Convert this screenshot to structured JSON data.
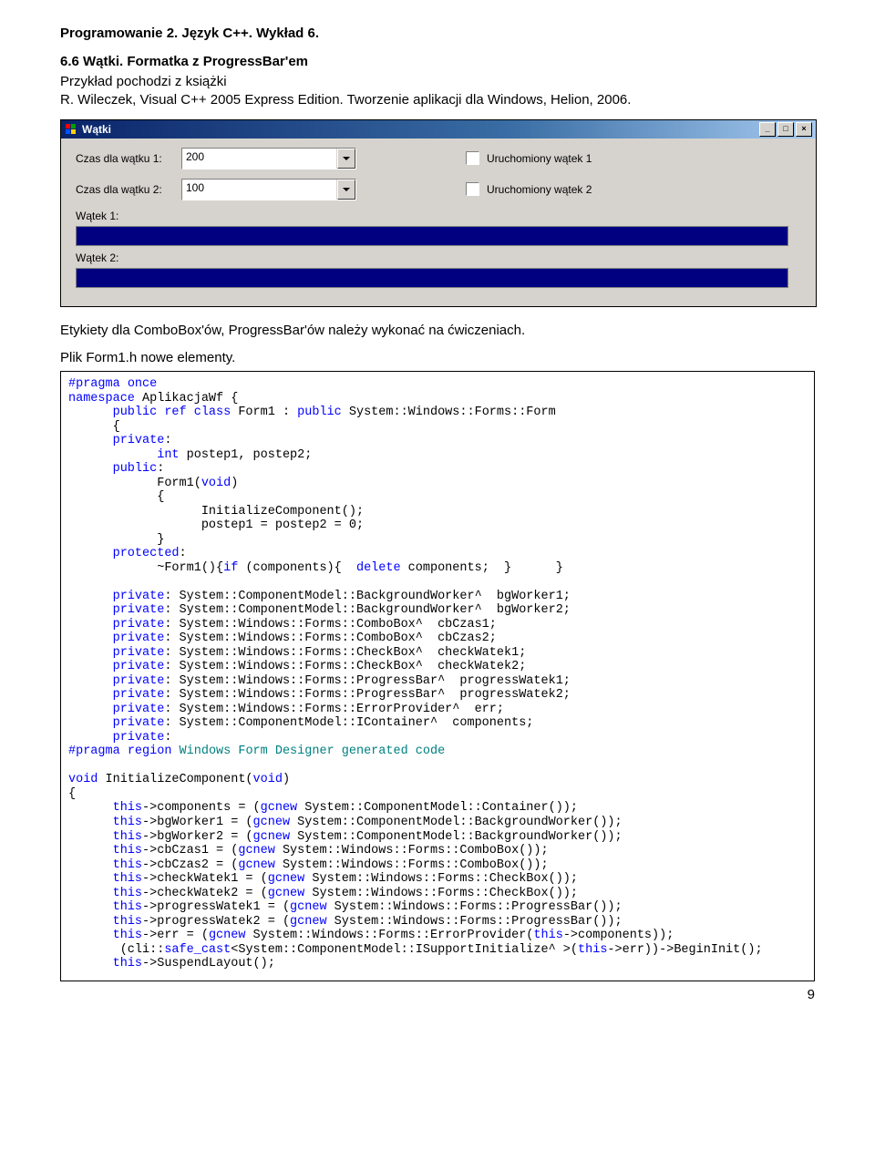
{
  "header": "Programowanie 2. Język C++. Wykład 6.",
  "section_title": "6.6 Wątki. Formatka z ProgressBar'em",
  "intro_line1": "Przykład pochodzi z książki",
  "intro_line2": "R. Wileczek, Visual C++ 2005 Express Edition. Tworzenie aplikacji dla Windows, Helion, 2006.",
  "window": {
    "title": "Wątki",
    "label_time1": "Czas dla wątku 1:",
    "label_time2": "Czas dla wątku 2:",
    "combo1_value": "200",
    "combo2_value": "100",
    "check1_label": "Uruchomiony wątek 1",
    "check2_label": "Uruchomiony wątek 2",
    "label_pbar1": "Wątek 1:",
    "label_pbar2": "Wątek 2:"
  },
  "after_shot1": "Etykiety dla ComboBox'ów, ProgressBar'ów należy wykonać na ćwiczeniach.",
  "after_shot2": "Plik Form1.h nowe elementy.",
  "code": {
    "l1a": "#pragma",
    "l1b": " once",
    "l2a": "namespace",
    "l2b": " AplikacjaWf {",
    "l3a1": "public",
    "l3a2": " ref",
    "l3a3": " class",
    "l3b": " Form1 : ",
    "l3c": "public",
    "l3d": " System::Windows::Forms::Form",
    "l4": "      {",
    "l5a": "private",
    "l5b": ":",
    "l6a": "int",
    "l6b": " postep1, postep2;",
    "l7a": "public",
    "l7b": ":",
    "l8a": "            Form1(",
    "l8b": "void",
    "l8c": ")",
    "l9": "            {",
    "l10": "                  InitializeComponent();",
    "l11": "                  postep1 = postep2 = 0;",
    "l12": "            }",
    "l13a": "protected",
    "l13b": ":",
    "l14a": "            ~Form1(){",
    "l14b": "if",
    "l14c": " (components){  ",
    "l14d": "delete",
    "l14e": " components;  }      }",
    "p1a": "private",
    "p1b": ": System::ComponentModel::BackgroundWorker^  bgWorker1;",
    "p2a": "private",
    "p2b": ": System::ComponentModel::BackgroundWorker^  bgWorker2;",
    "p3a": "private",
    "p3b": ": System::Windows::Forms::ComboBox^  cbCzas1;",
    "p4a": "private",
    "p4b": ": System::Windows::Forms::ComboBox^  cbCzas2;",
    "p5a": "private",
    "p5b": ": System::Windows::Forms::CheckBox^  checkWatek1;",
    "p6a": "private",
    "p6b": ": System::Windows::Forms::CheckBox^  checkWatek2;",
    "p7a": "private",
    "p7b": ": System::Windows::Forms::ProgressBar^  progressWatek1;",
    "p8a": "private",
    "p8b": ": System::Windows::Forms::ProgressBar^  progressWatek2;",
    "p9a": "private",
    "p9b": ": System::Windows::Forms::ErrorProvider^  err;",
    "p10a": "private",
    "p10b": ": System::ComponentModel::IContainer^  components;",
    "p11a": "private",
    "p11b": ":",
    "pr1a": "#pragma",
    "pr1b": " region",
    "pr1c": " Windows Form Designer generated code",
    "ic1a": "void",
    "ic1b": " InitializeComponent(",
    "ic1c": "void",
    "ic1d": ")",
    "ic2": "{",
    "t1a": "this",
    "t1b": "->components = (",
    "t1c": "gcnew",
    "t1d": " System::ComponentModel::Container());",
    "t2a": "this",
    "t2b": "->bgWorker1 = (",
    "t2c": "gcnew",
    "t2d": " System::ComponentModel::BackgroundWorker());",
    "t3a": "this",
    "t3b": "->bgWorker2 = (",
    "t3c": "gcnew",
    "t3d": " System::ComponentModel::BackgroundWorker());",
    "t4a": "this",
    "t4b": "->cbCzas1 = (",
    "t4c": "gcnew",
    "t4d": " System::Windows::Forms::ComboBox());",
    "t5a": "this",
    "t5b": "->cbCzas2 = (",
    "t5c": "gcnew",
    "t5d": " System::Windows::Forms::ComboBox());",
    "t6a": "this",
    "t6b": "->checkWatek1 = (",
    "t6c": "gcnew",
    "t6d": " System::Windows::Forms::CheckBox());",
    "t7a": "this",
    "t7b": "->checkWatek2 = (",
    "t7c": "gcnew",
    "t7d": " System::Windows::Forms::CheckBox());",
    "t8a": "this",
    "t8b": "->progressWatek1 = (",
    "t8c": "gcnew",
    "t8d": " System::Windows::Forms::ProgressBar());",
    "t9a": "this",
    "t9b": "->progressWatek2 = (",
    "t9c": "gcnew",
    "t9d": " System::Windows::Forms::ProgressBar());",
    "t10a": "this",
    "t10b": "->err = (",
    "t10c": "gcnew",
    "t10d": " System::Windows::Forms::ErrorProvider(",
    "t10e": "this",
    "t10f": "->components));",
    "t11a": " (cli::",
    "t11b": "safe_cast",
    "t11c": "<System::ComponentModel::ISupportInitialize^ >(",
    "t11d": "this",
    "t11e": "->err))->BeginInit();",
    "t12a": "this",
    "t12b": "->SuspendLayout();"
  },
  "page_number": "9"
}
